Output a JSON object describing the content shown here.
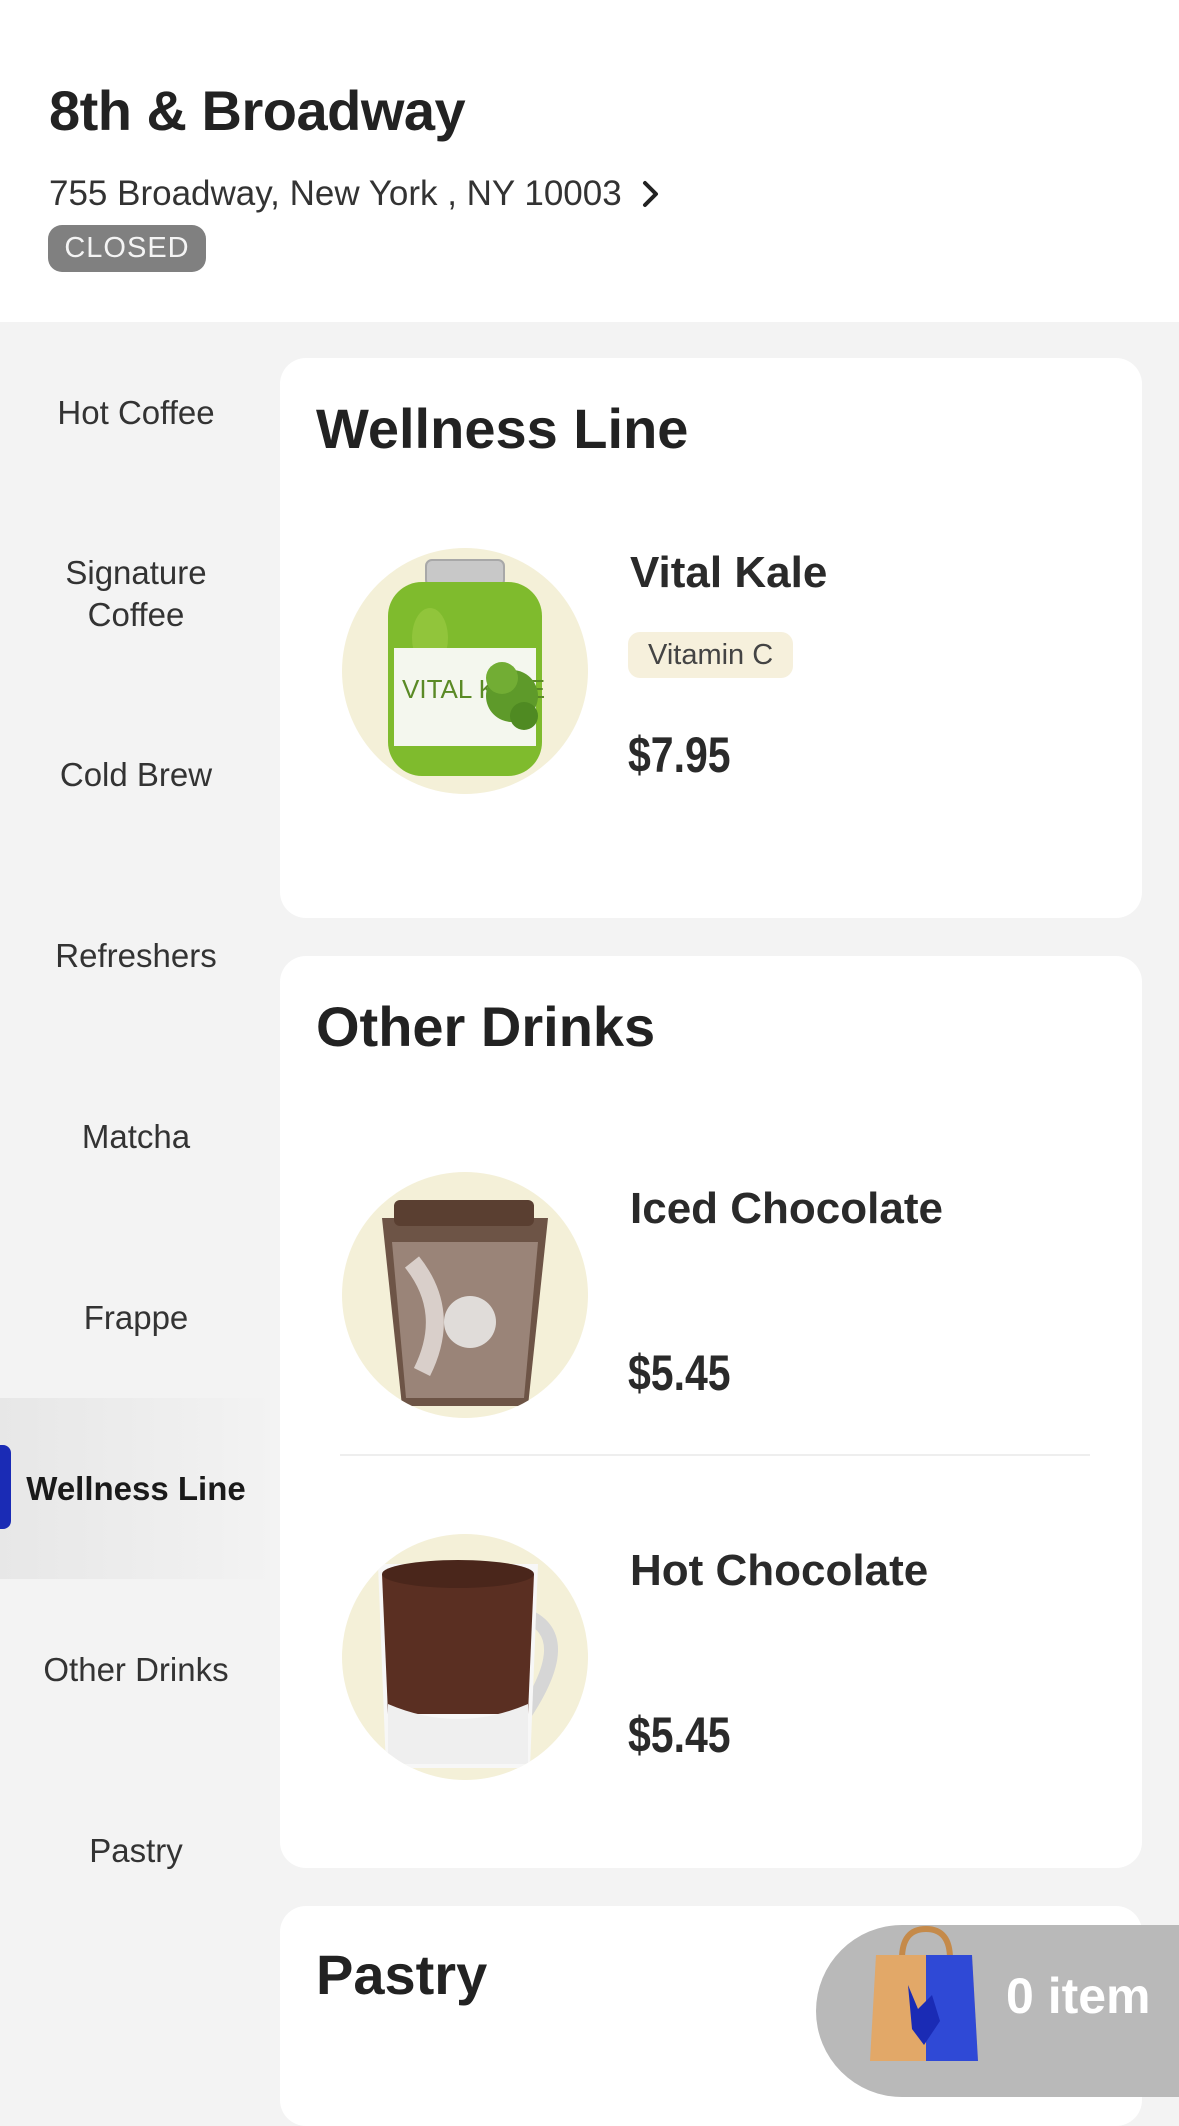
{
  "store": {
    "name": "8th & Broadway",
    "address": "755 Broadway, New York , NY 10003",
    "status": "CLOSED"
  },
  "sidebar": {
    "items": [
      {
        "label": "Hot Coffee"
      },
      {
        "label": "Signature Coffee"
      },
      {
        "label": "Cold Brew"
      },
      {
        "label": "Refreshers"
      },
      {
        "label": "Matcha"
      },
      {
        "label": "Frappe"
      },
      {
        "label": "Wellness Line",
        "active": true
      },
      {
        "label": "Other Drinks"
      },
      {
        "label": "Pastry"
      }
    ]
  },
  "sections": {
    "wellness": {
      "title": "Wellness Line",
      "products": [
        {
          "name": "Vital Kale",
          "tag": "Vitamin C",
          "price": "$7.95",
          "jar_text": "VITAL KALE"
        }
      ]
    },
    "other": {
      "title": "Other Drinks",
      "products": [
        {
          "name": "Iced Chocolate",
          "price": "$5.45"
        },
        {
          "name": "Hot Chocolate",
          "price": "$5.45"
        }
      ]
    },
    "pastry": {
      "title": "Pastry"
    }
  },
  "cart": {
    "label": "0 item",
    "icon": "shopping-bag-icon"
  },
  "colors": {
    "accent": "#1a2bb5",
    "badge": "#808080",
    "thumb_bg": "#f4f0d8"
  }
}
